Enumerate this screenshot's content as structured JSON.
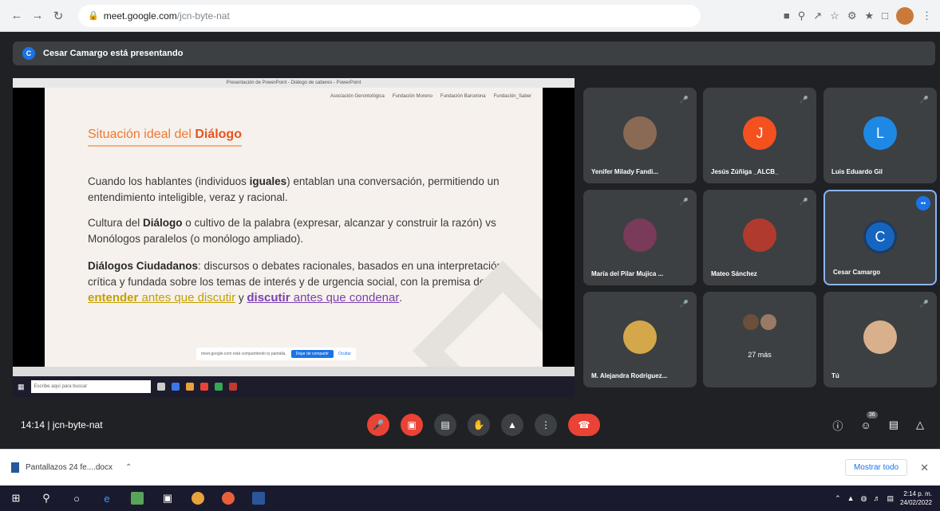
{
  "browser": {
    "url_host": "meet.google.com",
    "url_path": "/jcn-byte-nat"
  },
  "meet": {
    "presenting_text": "Cesar Camargo está presentando",
    "presenter_initial": "C",
    "time": "14:14",
    "meeting_code": "jcn-byte-nat"
  },
  "slide": {
    "window_title": "Presentación de PowerPoint - Diálogo de saberes - PowerPoint",
    "logos": [
      "Asociación Gerontológica",
      "Fundación Moreno",
      "Fundación Barcelona",
      "Fundación_Saber"
    ],
    "title_normal": "Situación ideal del ",
    "title_bold": "Diálogo",
    "p1_a": "Cuando los hablantes (individuos ",
    "p1_b": "iguales",
    "p1_c": ") entablan una conversación, permitiendo un entendimiento inteligible, veraz y racional.",
    "p2_a": "Cultura del ",
    "p2_b": "Diálogo",
    "p2_c": " o cultivo de la palabra (expresar, alcanzar y construir la razón) vs Monólogos paralelos (o monólogo ampliado).",
    "p3_a": "Diálogos Ciudadanos",
    "p3_b": ": discursos o debates racionales, basados en una interpretación crítica y fundada sobre los temas de interés y de urgencia social, con la premisa de ",
    "p3_c": "entender",
    "p3_d": " antes que discutir",
    "p3_e": " y ",
    "p3_f": "discutir",
    "p3_g": " antes que condenar",
    "p3_h": ".",
    "share_notice": "meet.google.com está compartiendo tu pantalla.",
    "stop_share": "Dejar de compartir",
    "hide": "Ocultar",
    "search_placeholder": "Escribe aquí para buscar"
  },
  "participants": [
    {
      "name": "Yenifer Milady Fandi...",
      "initial": "",
      "color": "#8a6a55"
    },
    {
      "name": "Jesús Zúñiga _ALCB_",
      "initial": "J",
      "color": "#f4511e"
    },
    {
      "name": "Luis Eduardo Gil",
      "initial": "L",
      "color": "#1e88e5"
    },
    {
      "name": "María del Pilar Mujica ...",
      "initial": "",
      "color": "#7a3a5a"
    },
    {
      "name": "Mateo Sánchez",
      "initial": "",
      "color": "#b03a2e"
    },
    {
      "name": "Cesar Camargo",
      "initial": "C",
      "color": "#1565c0"
    },
    {
      "name": "M. Alejandra Rodríguez...",
      "initial": "",
      "color": "#d4a84a"
    },
    {
      "name": "",
      "more": "27 más"
    },
    {
      "name": "Tú",
      "initial": "",
      "color": "#d9b08c"
    }
  ],
  "people_count": "36",
  "downloads": {
    "file": "Pantallazos 24 fe....docx",
    "show_all": "Mostrar todo"
  },
  "taskbar": {
    "time": "2:14 p. m.",
    "date": "24/02/2022"
  },
  "colors": {
    "meet_bg": "#202124",
    "tile_bg": "#3c4043",
    "red": "#ea4335",
    "accent": "#1a73e8"
  }
}
